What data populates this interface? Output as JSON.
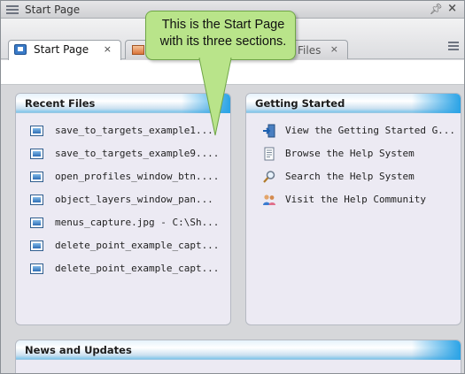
{
  "window": {
    "title": "Start Page"
  },
  "tabs": [
    {
      "label": "Start Page",
      "close": "×",
      "active": true
    },
    {
      "label": "",
      "close": "",
      "active": false
    },
    {
      "label": "Files",
      "close": "×",
      "active": false
    }
  ],
  "callout": {
    "text_line1": "This is the Start Page",
    "text_line2": "with its three sections."
  },
  "recent_files": {
    "title": "Recent Files",
    "items": [
      "save_to_targets_example1...",
      "save_to_targets_example9....",
      "open_profiles_window_btn....",
      "object_layers_window_pan...",
      "menus_capture.jpg - C:\\Sh...",
      "delete_point_example_capt...",
      "delete_point_example_capt..."
    ]
  },
  "getting_started": {
    "title": "Getting Started",
    "items": [
      {
        "label": "View the Getting Started G...",
        "icon": "arrow-door-icon"
      },
      {
        "label": "Browse the Help System",
        "icon": "document-icon"
      },
      {
        "label": "Search the Help System",
        "icon": "magnifier-icon"
      },
      {
        "label": "Visit the Help Community",
        "icon": "people-icon"
      }
    ]
  },
  "news": {
    "title": "News and Updates"
  },
  "colors": {
    "callout_fill": "#b9e48a",
    "header_accent": "#2aa3e6"
  }
}
